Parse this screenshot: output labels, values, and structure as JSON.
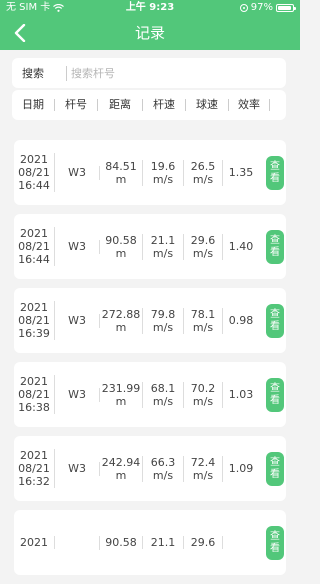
{
  "status_bar": {
    "carrier": "无 SIM 卡",
    "time": "上午 9:23",
    "battery": "97%"
  },
  "nav": {
    "title": "记录",
    "back_icon": "chevron-left-icon"
  },
  "search": {
    "label": "搜索",
    "placeholder": "搜索杆号"
  },
  "columns": [
    "日期",
    "杆号",
    "距离",
    "杆速",
    "球速",
    "效率"
  ],
  "records": [
    {
      "date": [
        "2021",
        "08/21",
        "16:44"
      ],
      "club": "W3",
      "distance": [
        "84.51",
        "m"
      ],
      "club_speed": [
        "19.6",
        "m/s"
      ],
      "ball_speed": [
        "26.5",
        "m/s"
      ],
      "efficiency": "1.35",
      "action": "查看"
    },
    {
      "date": [
        "2021",
        "08/21",
        "16:44"
      ],
      "club": "W3",
      "distance": [
        "90.58",
        "m"
      ],
      "club_speed": [
        "21.1",
        "m/s"
      ],
      "ball_speed": [
        "29.6",
        "m/s"
      ],
      "efficiency": "1.40",
      "action": "查看"
    },
    {
      "date": [
        "2021",
        "08/21",
        "16:39"
      ],
      "club": "W3",
      "distance": [
        "272.88",
        "m"
      ],
      "club_speed": [
        "79.8",
        "m/s"
      ],
      "ball_speed": [
        "78.1",
        "m/s"
      ],
      "efficiency": "0.98",
      "action": "查看"
    },
    {
      "date": [
        "2021",
        "08/21",
        "16:38"
      ],
      "club": "W3",
      "distance": [
        "231.99",
        "m"
      ],
      "club_speed": [
        "68.1",
        "m/s"
      ],
      "ball_speed": [
        "70.2",
        "m/s"
      ],
      "efficiency": "1.03",
      "action": "查看"
    },
    {
      "date": [
        "2021",
        "08/21",
        "16:32"
      ],
      "club": "W3",
      "distance": [
        "242.94",
        "m"
      ],
      "club_speed": [
        "66.3",
        "m/s"
      ],
      "ball_speed": [
        "72.4",
        "m/s"
      ],
      "efficiency": "1.09",
      "action": "查看"
    },
    {
      "date": [
        "2021",
        "",
        ""
      ],
      "club": "",
      "distance": [
        "90.58",
        ""
      ],
      "club_speed": [
        "21.1",
        ""
      ],
      "ball_speed": [
        "29.6",
        ""
      ],
      "efficiency": "",
      "action": "查看"
    }
  ],
  "colors": {
    "accent": "#52c77a",
    "background": "#f3f3f3"
  }
}
